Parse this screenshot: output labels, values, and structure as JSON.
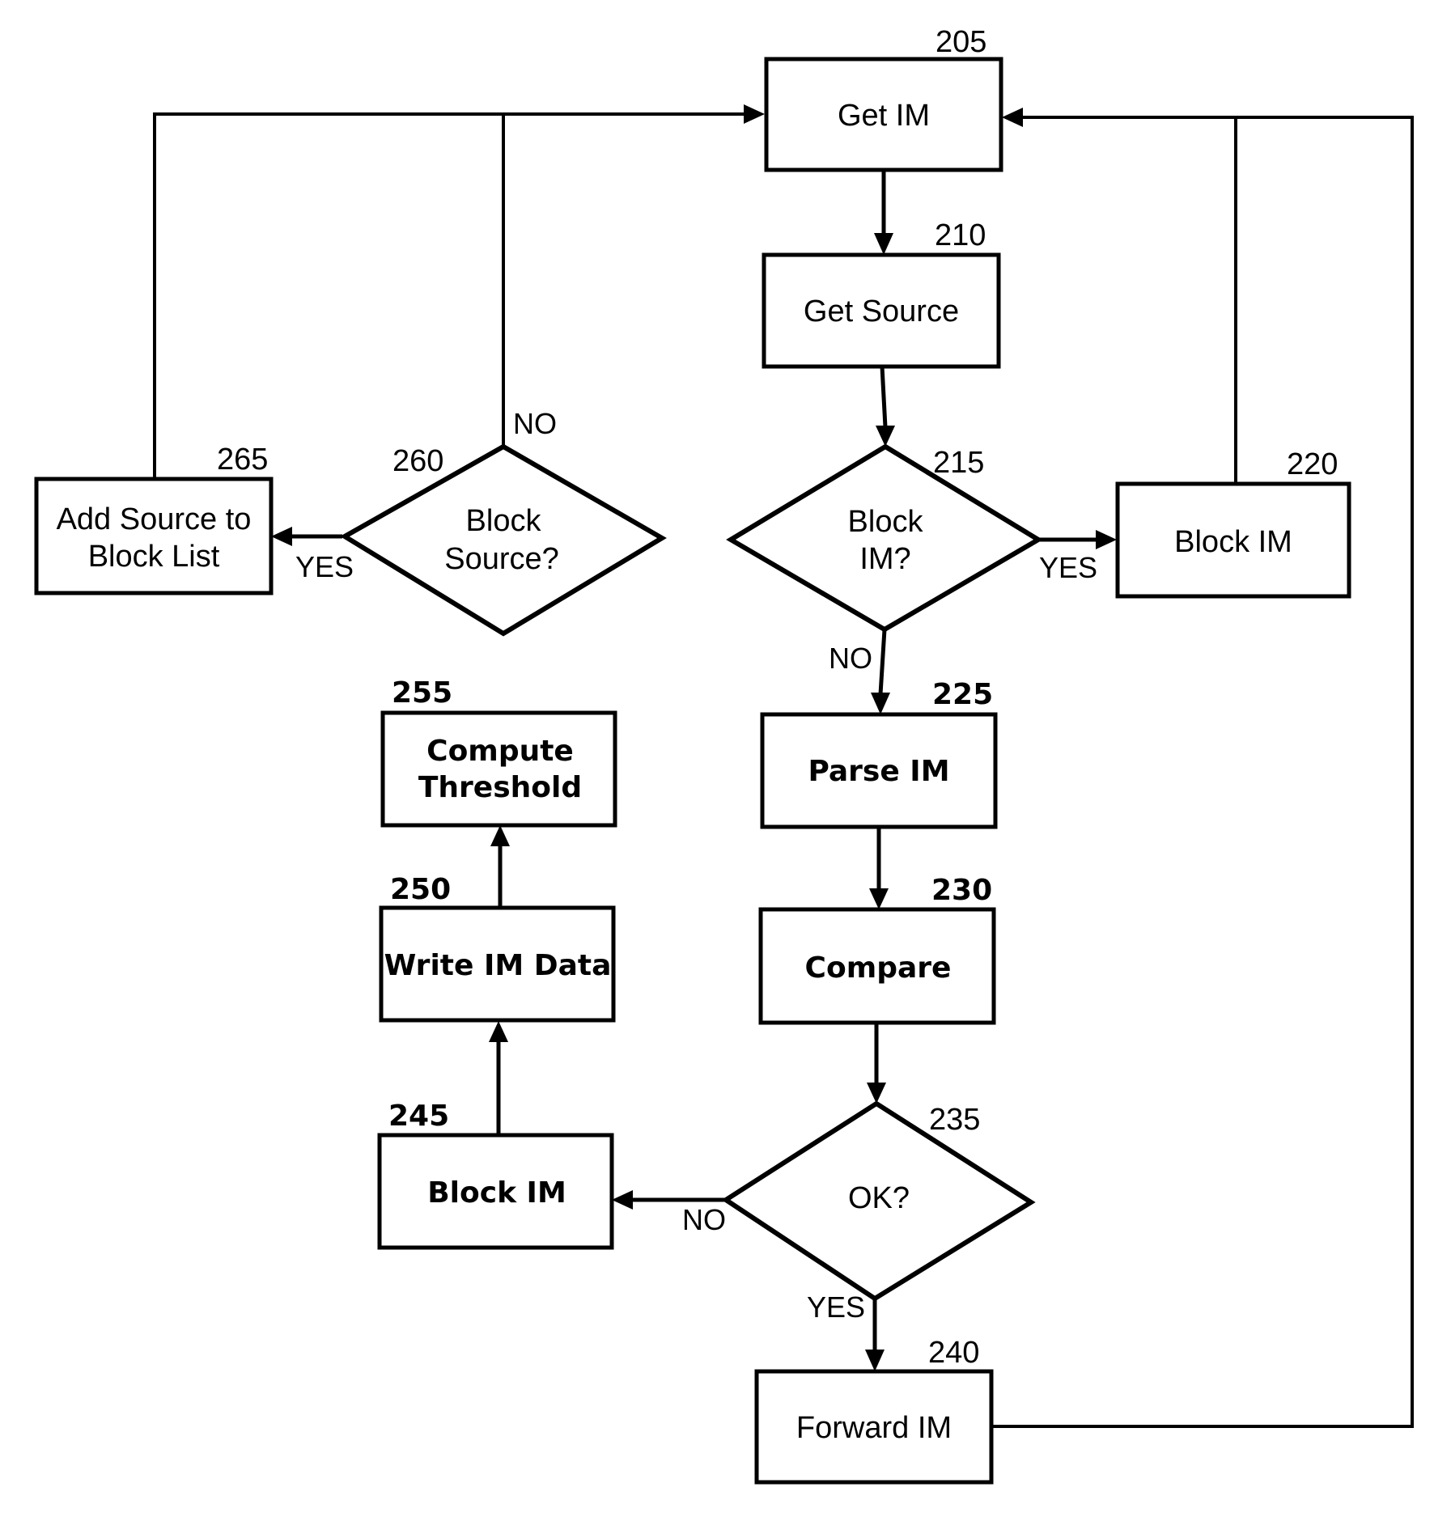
{
  "figure": {
    "type": "flowchart",
    "title": "",
    "nodes": [
      {
        "id": "205",
        "ref": "205",
        "shape": "process",
        "label": [
          "Get IM"
        ]
      },
      {
        "id": "210",
        "ref": "210",
        "shape": "process",
        "label": [
          "Get Source"
        ]
      },
      {
        "id": "215",
        "ref": "215",
        "shape": "decision",
        "label": [
          "Block",
          "IM?"
        ]
      },
      {
        "id": "220",
        "ref": "220",
        "shape": "process",
        "label": [
          "Block IM"
        ]
      },
      {
        "id": "225",
        "ref": "225",
        "shape": "process",
        "label": [
          "Parse IM"
        ]
      },
      {
        "id": "230",
        "ref": "230",
        "shape": "process",
        "label": [
          "Compare"
        ]
      },
      {
        "id": "235",
        "ref": "235",
        "shape": "decision",
        "label": [
          "OK?"
        ]
      },
      {
        "id": "240",
        "ref": "240",
        "shape": "process",
        "label": [
          "Forward IM"
        ]
      },
      {
        "id": "245",
        "ref": "245",
        "shape": "process",
        "label": [
          "Block IM"
        ]
      },
      {
        "id": "250",
        "ref": "250",
        "shape": "process",
        "label": [
          "Write IM Data"
        ]
      },
      {
        "id": "255",
        "ref": "255",
        "shape": "process",
        "label": [
          "Compute",
          "Threshold"
        ]
      },
      {
        "id": "260",
        "ref": "260",
        "shape": "decision",
        "label": [
          "Block",
          "Source?"
        ]
      },
      {
        "id": "265",
        "ref": "265",
        "shape": "process",
        "label": [
          "Add Source to",
          "Block List"
        ]
      }
    ],
    "edges": [
      {
        "from": "205",
        "to": "210",
        "label": ""
      },
      {
        "from": "210",
        "to": "215",
        "label": ""
      },
      {
        "from": "215",
        "to": "220",
        "label": "YES"
      },
      {
        "from": "215",
        "to": "225",
        "label": "NO"
      },
      {
        "from": "220",
        "to": "205",
        "label": ""
      },
      {
        "from": "225",
        "to": "230",
        "label": ""
      },
      {
        "from": "230",
        "to": "235",
        "label": ""
      },
      {
        "from": "235",
        "to": "240",
        "label": "YES"
      },
      {
        "from": "235",
        "to": "245",
        "label": "NO"
      },
      {
        "from": "240",
        "to": "205",
        "label": ""
      },
      {
        "from": "245",
        "to": "250",
        "label": ""
      },
      {
        "from": "250",
        "to": "255",
        "label": ""
      },
      {
        "from": "255",
        "to": "260",
        "label": ""
      },
      {
        "from": "260",
        "to": "265",
        "label": "YES"
      },
      {
        "from": "260",
        "to": "205",
        "label": "NO"
      },
      {
        "from": "265",
        "to": "205",
        "label": ""
      }
    ],
    "branch_labels": {
      "yes": "YES",
      "no": "NO"
    }
  }
}
